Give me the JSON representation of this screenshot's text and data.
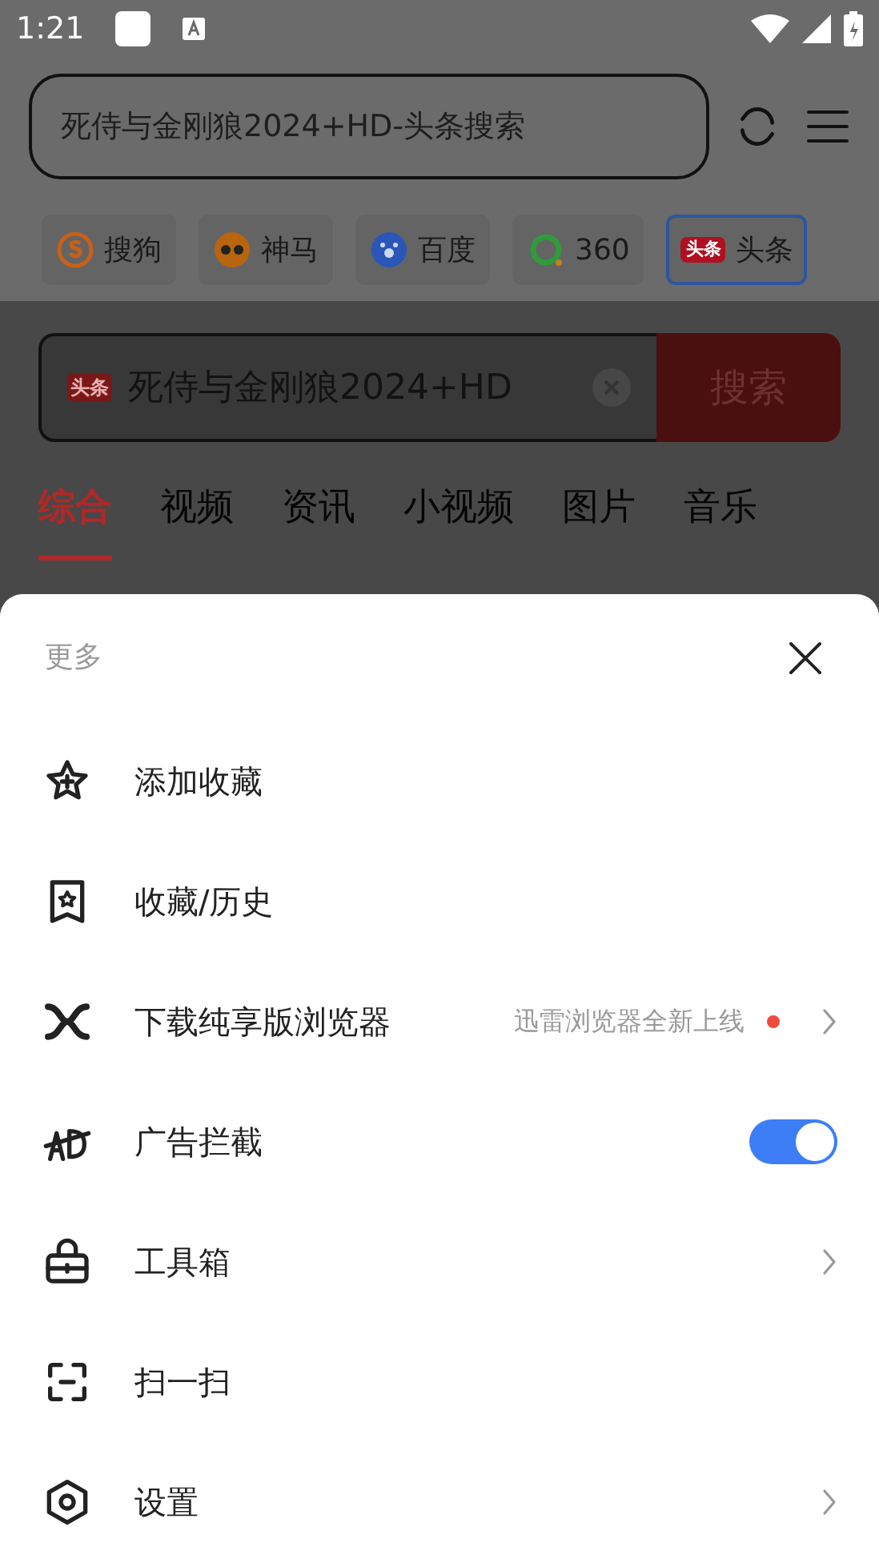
{
  "status_bar": {
    "time": "1:21"
  },
  "address_bar": {
    "value": "死侍与金刚狼2024+HD-头条搜索"
  },
  "engines": [
    {
      "label": "搜狗",
      "selected": false,
      "color": "#c8601a"
    },
    {
      "label": "神马",
      "selected": false,
      "color": "#b8650f"
    },
    {
      "label": "百度",
      "selected": false,
      "color": "#2a56b8"
    },
    {
      "label": "360",
      "selected": false,
      "color": "#2f9b3c"
    },
    {
      "label": "头条",
      "selected": true,
      "color": "#b01020",
      "logo_text": "头条"
    }
  ],
  "search": {
    "logo_text": "头条",
    "value": "死侍与金刚狼2024+HD",
    "button": "搜索"
  },
  "result_tabs": [
    {
      "label": "综合",
      "selected": true
    },
    {
      "label": "视频",
      "selected": false
    },
    {
      "label": "资讯",
      "selected": false
    },
    {
      "label": "小视频",
      "selected": false
    },
    {
      "label": "图片",
      "selected": false
    },
    {
      "label": "音乐",
      "selected": false
    }
  ],
  "sheet": {
    "title": "更多",
    "items": [
      {
        "kind": "plain",
        "label": "添加收藏"
      },
      {
        "kind": "plain",
        "label": "收藏/历史"
      },
      {
        "kind": "link",
        "label": "下载纯享版浏览器",
        "note": "迅雷浏览器全新上线",
        "dot": true
      },
      {
        "kind": "toggle",
        "label": "广告拦截",
        "on": true
      },
      {
        "kind": "link",
        "label": "工具箱"
      },
      {
        "kind": "plain",
        "label": "扫一扫"
      },
      {
        "kind": "link",
        "label": "设置"
      }
    ]
  }
}
